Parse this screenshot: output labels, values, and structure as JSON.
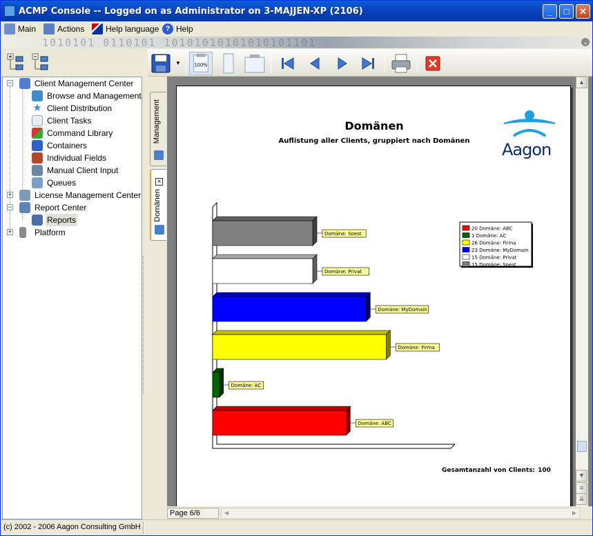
{
  "window": {
    "title": "ACMP Console -- Logged on as Administrator on 3-MAJJEN-XP (2106)"
  },
  "menu": [
    {
      "label": "Main",
      "icon": "main-icon"
    },
    {
      "label": "Actions",
      "icon": "actions-icon"
    },
    {
      "label": "Help language",
      "icon": "flag-icon"
    },
    {
      "label": "Help",
      "icon": "help-icon"
    }
  ],
  "banner": {
    "text": "1010101 0110101 10101010101010101101"
  },
  "tree": {
    "items": [
      {
        "label": "Client Management Center",
        "icon": "client-management-icon",
        "expander": "−"
      },
      {
        "label": "Browse and Management",
        "icon": "browse-icon"
      },
      {
        "label": "Client Distribution",
        "icon": "star-icon"
      },
      {
        "label": "Client Tasks",
        "icon": "tasks-icon"
      },
      {
        "label": "Command Library",
        "icon": "puzzle-icon"
      },
      {
        "label": "Containers",
        "icon": "containers-icon"
      },
      {
        "label": "Individual Fields",
        "icon": "fields-icon"
      },
      {
        "label": "Manual Client Input",
        "icon": "manual-input-icon"
      },
      {
        "label": "Queues",
        "icon": "queues-icon"
      },
      {
        "label": "License Management Center",
        "icon": "license-icon",
        "expander": "+"
      },
      {
        "label": "Report Center",
        "icon": "report-center-icon",
        "expander": "−"
      },
      {
        "label": "Reports",
        "icon": "reports-icon"
      },
      {
        "label": "Platform",
        "icon": "platform-icon",
        "expander": "+"
      }
    ]
  },
  "tabs": [
    {
      "label": "Management"
    },
    {
      "label": "Domänen"
    }
  ],
  "tab_close": "×",
  "report": {
    "title": "Domänen",
    "subtitle": "Auflistung aller Clients, gruppiert nach Domänen",
    "logo_text": "Aagon",
    "total_label": "Gesamtanzahl von Clients:",
    "total_value": "100"
  },
  "chart_data": {
    "type": "bar",
    "orientation": "horizontal",
    "bar_style": "3d",
    "categories": [
      "Domäne: Soest",
      "Domäne: Privat",
      "Domäne: MyDomain",
      "Domäne: Firma",
      "Domäne: AC",
      "Domäne: ABC"
    ],
    "values": [
      15,
      15,
      23,
      26,
      1,
      20
    ],
    "colors": [
      "#808080",
      "#ffffff",
      "#0000ff",
      "#ffff00",
      "#006400",
      "#ff0000"
    ],
    "xlim": [
      0,
      30
    ],
    "legend": [
      {
        "label": "20 Domäne: ABC",
        "color": "#ff0000"
      },
      {
        "label": "1 Domäne: AC",
        "color": "#006400"
      },
      {
        "label": "26 Domäne: Firma",
        "color": "#ffff00"
      },
      {
        "label": "23 Domäne: MyDomain",
        "color": "#0000ff"
      },
      {
        "label": "15 Domäne: Privat",
        "color": "#ffffff"
      },
      {
        "label": "15 Domäne: Soest",
        "color": "#808080"
      }
    ],
    "legend_position": "top-right"
  },
  "status": {
    "page": "Page 6/6",
    "copyright": "(c) 2002 - 2006 Aagon Consulting GmbH"
  },
  "toolbar": {
    "zoom_label": "100%"
  }
}
